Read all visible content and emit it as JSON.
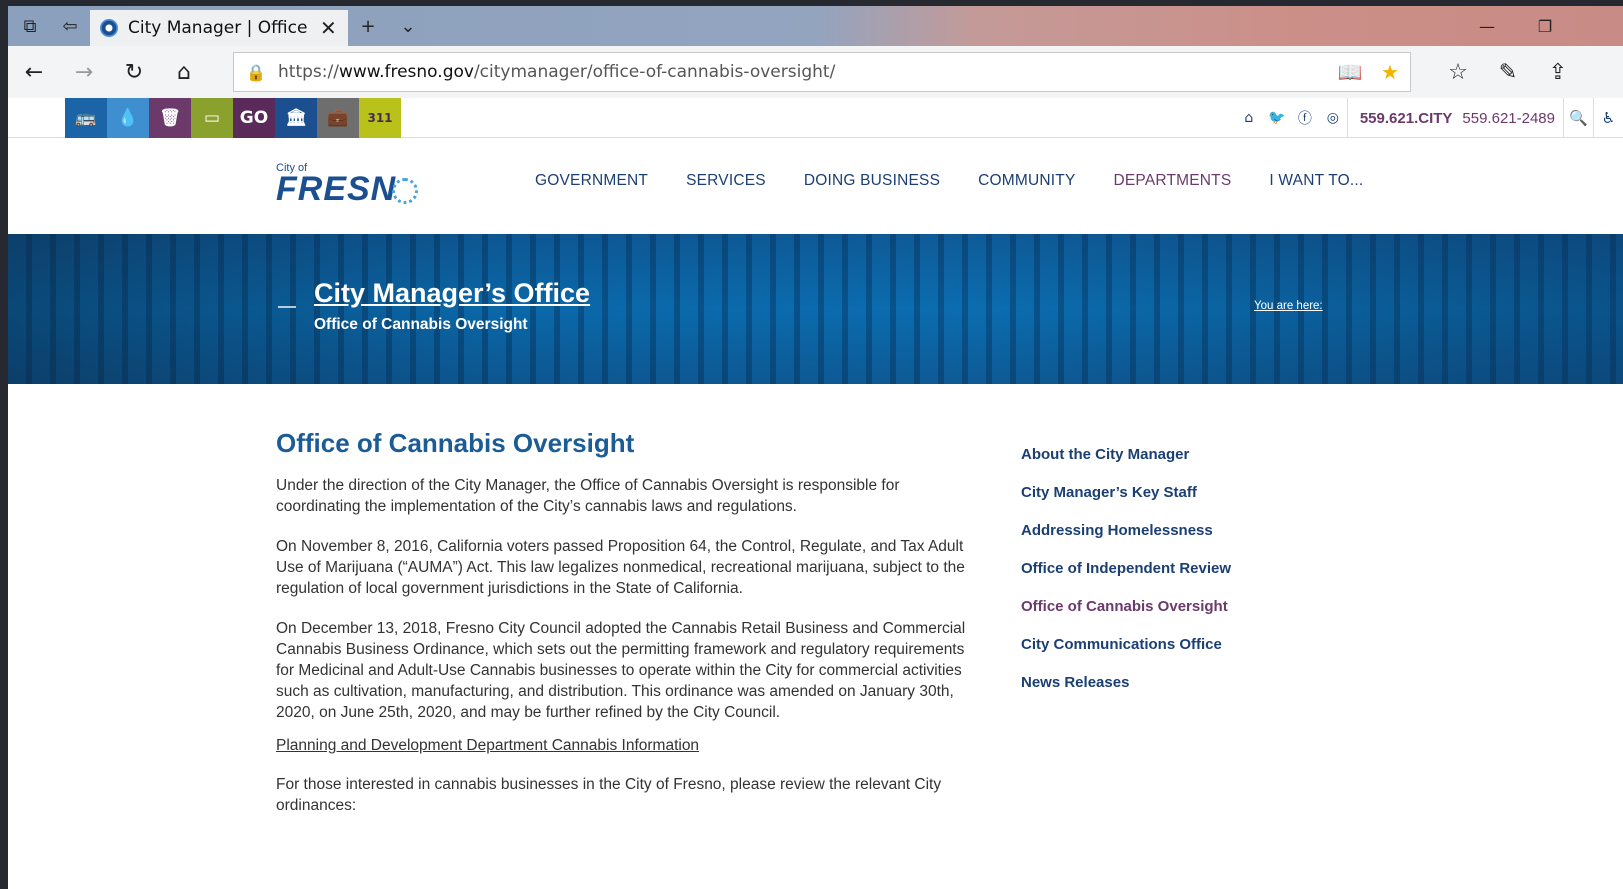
{
  "browser": {
    "tab_title": "City Manager | Office of Cannabis Oversight",
    "url_prefix": "https://",
    "url_domain": "www.fresno.gov",
    "url_path": "/citymanager/office-of-cannabis-oversight/"
  },
  "utility": {
    "quick_icons": [
      {
        "name": "bus-icon",
        "glyph": "🚌",
        "color": "#1b64a8"
      },
      {
        "name": "water-drop-icon",
        "glyph": "💧",
        "color": "#3f8fd0"
      },
      {
        "name": "trash-icon",
        "glyph": "🗑",
        "color": "#6b3a6b"
      },
      {
        "name": "payment-card-icon",
        "glyph": "▭",
        "color": "#8aa12e"
      },
      {
        "name": "go-icon",
        "glyph": "GO",
        "color": "#5a2a5a"
      },
      {
        "name": "city-hall-icon",
        "glyph": "🏛",
        "color": "#1b4f8f"
      },
      {
        "name": "briefcase-icon",
        "glyph": "💼",
        "color": "#6e6e6e"
      },
      {
        "name": "311-icon",
        "glyph": "311",
        "color": "#b8c21a"
      }
    ],
    "phone_main": "559.621.CITY",
    "phone_number": "559.621-2489"
  },
  "header": {
    "logo_small": "City of",
    "logo_big": "FRESN",
    "nav": [
      "GOVERNMENT",
      "SERVICES",
      "DOING BUSINESS",
      "COMMUNITY",
      "DEPARTMENTS",
      "I WANT TO..."
    ]
  },
  "hero": {
    "title": "City Manager’s Office",
    "subtitle": "Office of Cannabis Oversight",
    "breadcrumb_label": "You are here:"
  },
  "main": {
    "heading": "Office of Cannabis Oversight",
    "p1": "Under the direction of the City Manager, the Office of Cannabis Oversight is responsible for coordinating the implementation of the City’s cannabis laws and regulations.",
    "p2": "On November 8, 2016, California voters passed Proposition 64, the Control, Regulate, and Tax Adult Use of Marijuana (“AUMA”) Act. This law legalizes nonmedical, recreational marijuana, subject to the regulation of local government jurisdictions in the State of California.",
    "p3": "On December 13, 2018, Fresno City Council adopted the Cannabis Retail Business and Commercial Cannabis Business Ordinance, which sets out the permitting framework and regulatory requirements for Medicinal and Adult-Use Cannabis businesses to operate within the City for commercial activities such as cultivation, manufacturing, and distribution. This ordinance was amended on January 30th, 2020, on June 25th, 2020, and may be further refined by the City Council.",
    "link": "Planning and Development Department Cannabis Information",
    "p4": "For those interested in cannabis businesses in the City of Fresno, please review the relevant City ordinances:"
  },
  "sidebar": {
    "items": [
      "About the City Manager",
      "City Manager’s Key Staff",
      "Addressing Homelessness",
      "Office of Independent Review",
      "Office of Cannabis Oversight",
      "City Communications Office",
      "News Releases"
    ]
  }
}
